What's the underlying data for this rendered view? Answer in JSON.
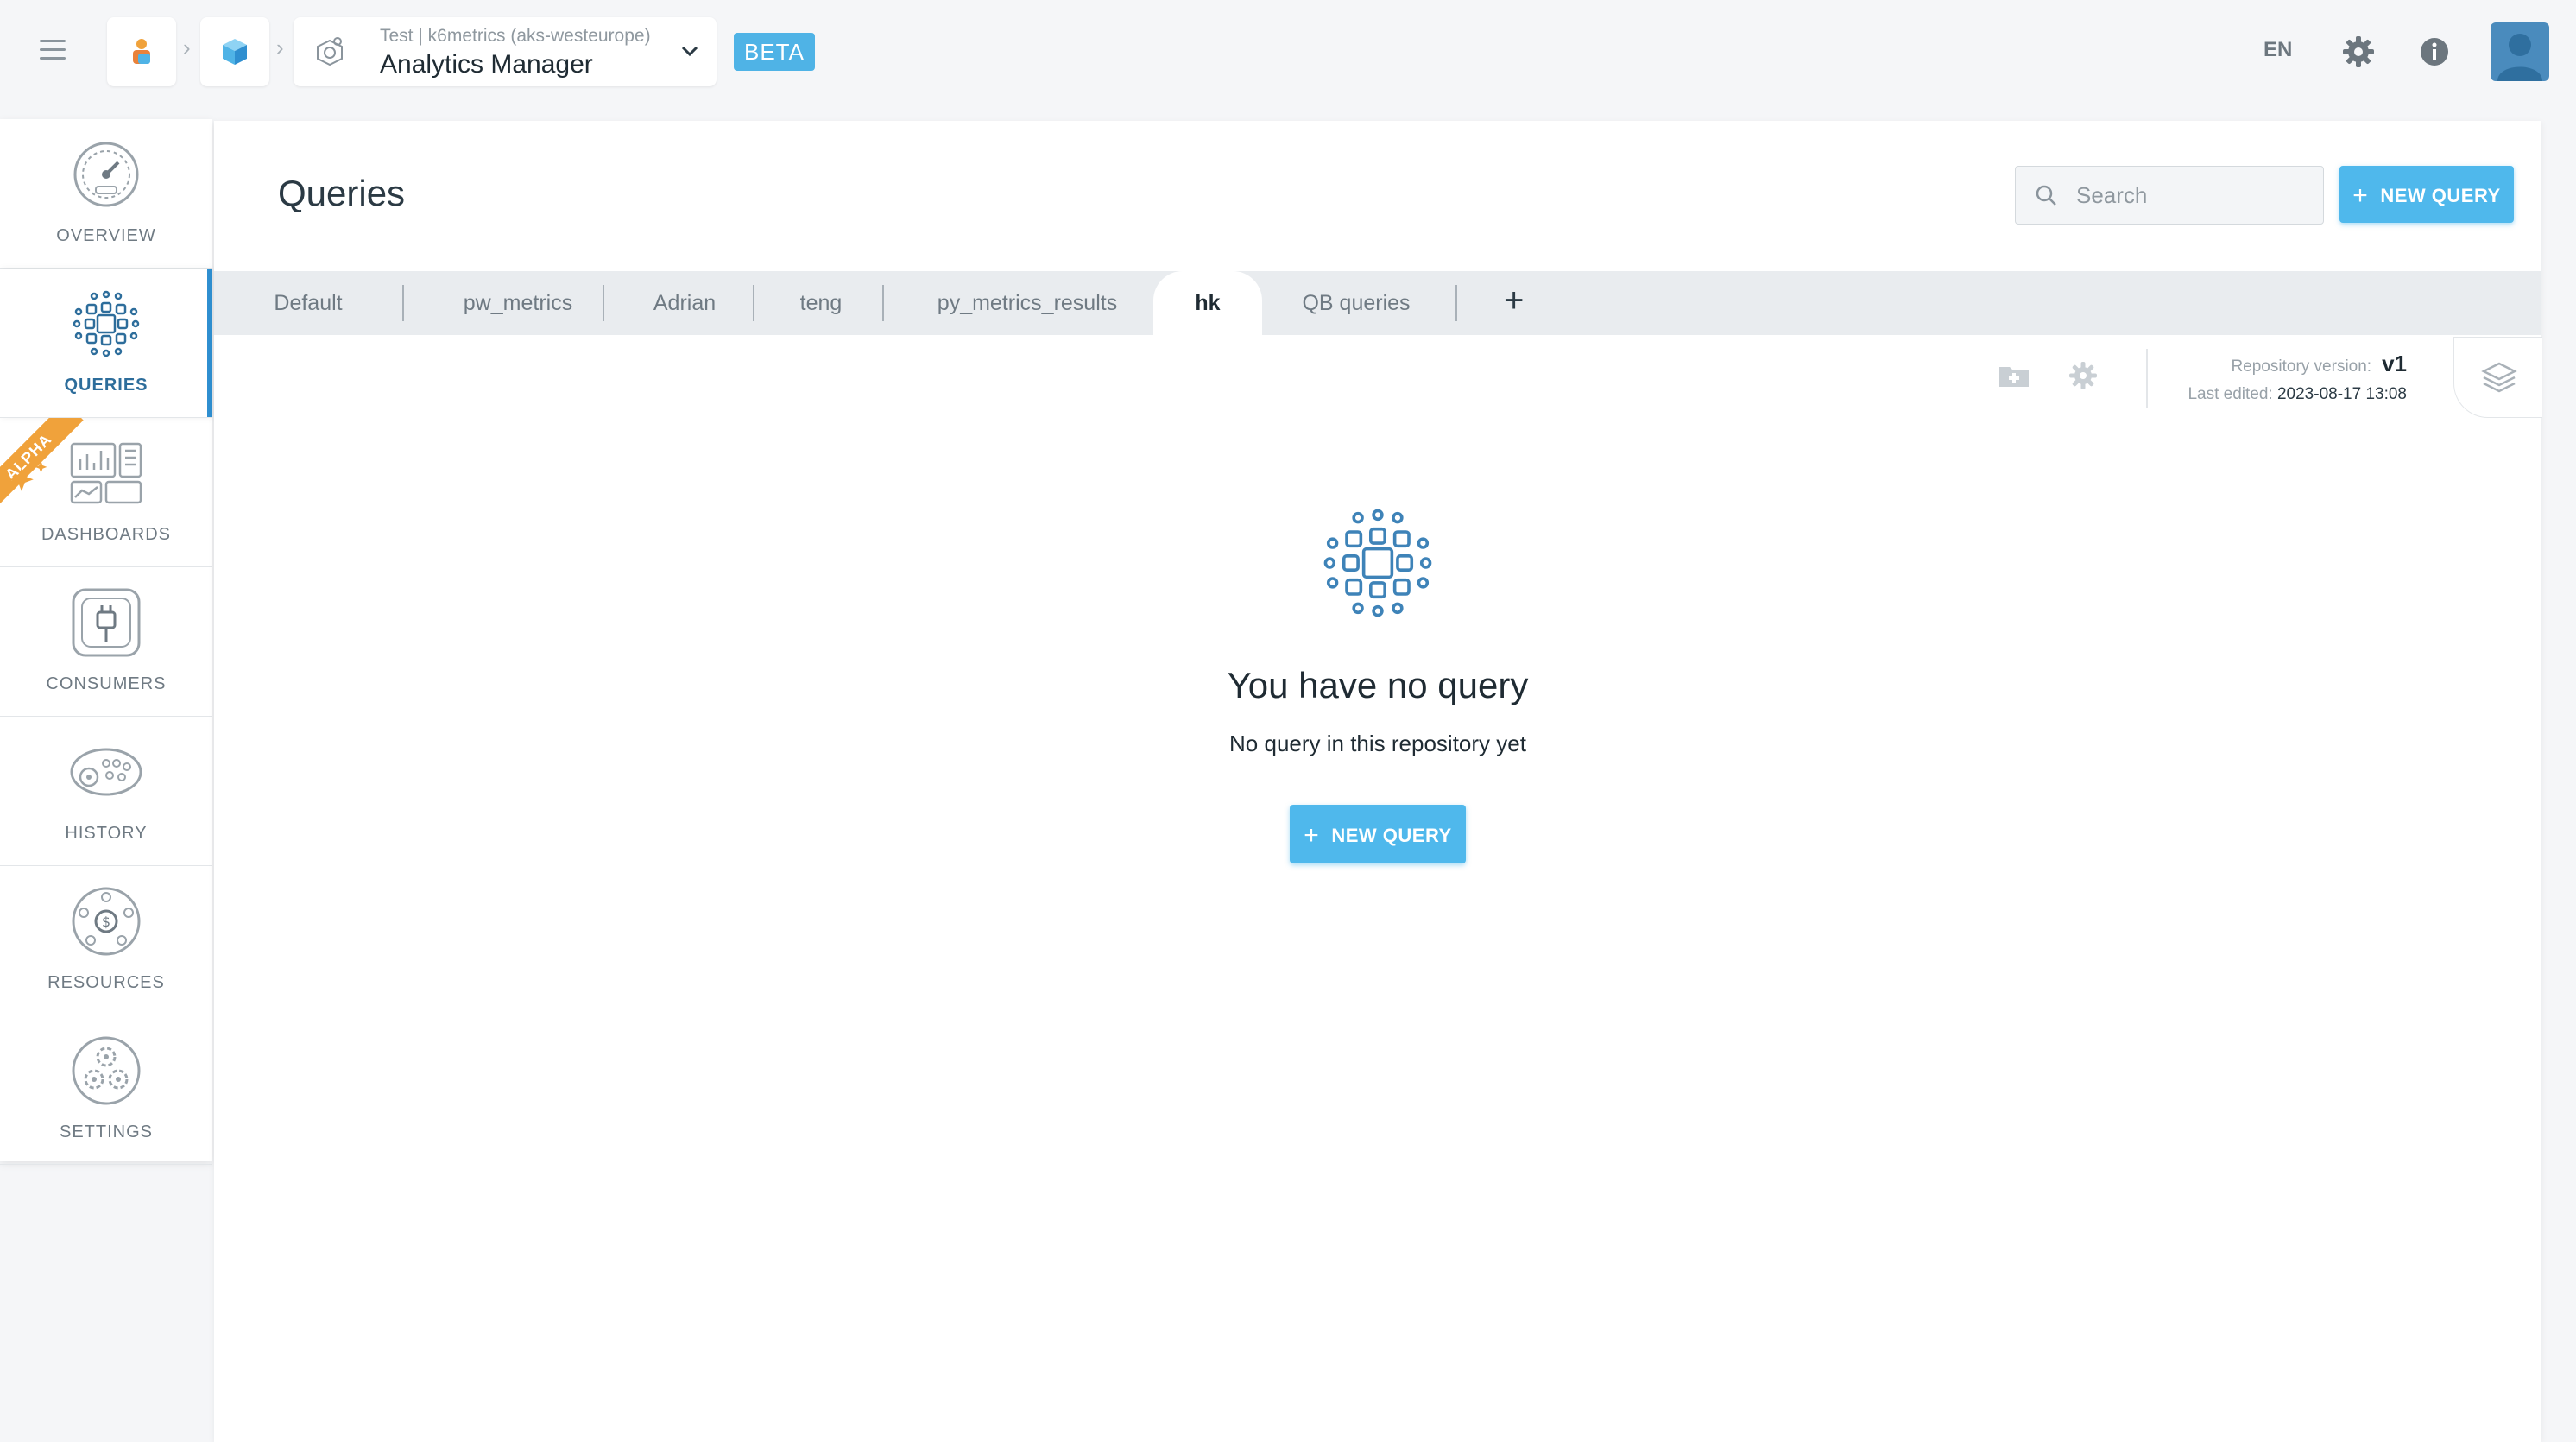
{
  "header": {
    "breadcrumb_sub_env": "Test",
    "breadcrumb_sub_sep": "|",
    "breadcrumb_sub_project": "k6metrics (aks-westeurope)",
    "app_title": "Analytics Manager",
    "beta_badge": "BETA",
    "language": "EN"
  },
  "sidebar": {
    "items": [
      {
        "label": "OVERVIEW",
        "icon": "speedometer-icon"
      },
      {
        "label": "QUERIES",
        "icon": "queries-grid-icon",
        "active": true
      },
      {
        "label": "DASHBOARDS",
        "icon": "dashboards-icon",
        "badge": "ALPHA"
      },
      {
        "label": "CONSUMERS",
        "icon": "plug-icon"
      },
      {
        "label": "HISTORY",
        "icon": "film-reel-icon"
      },
      {
        "label": "RESOURCES",
        "icon": "resources-icon"
      },
      {
        "label": "SETTINGS",
        "icon": "gears-icon"
      }
    ],
    "alpha_badge": "ALPHA"
  },
  "main": {
    "title": "Queries",
    "search_placeholder": "Search",
    "new_query_label": "NEW QUERY",
    "tabs": [
      "Default",
      "pw_metrics",
      "Adrian",
      "teng",
      "py_metrics_results",
      "hk",
      "QB queries"
    ],
    "active_tab": "hk",
    "add_tab": "+",
    "repository_version_label": "Repository version:",
    "repository_version": "v1",
    "last_edited_label": "Last edited:",
    "last_edited": "2023-08-17 13:08",
    "empty_title": "You have no query",
    "empty_subtitle": "No query in this repository yet",
    "empty_button": "NEW QUERY"
  },
  "colors": {
    "accent": "#4fb8ec",
    "active_nav": "#2f8fd0",
    "alpha_badge": "#f0a23b"
  }
}
